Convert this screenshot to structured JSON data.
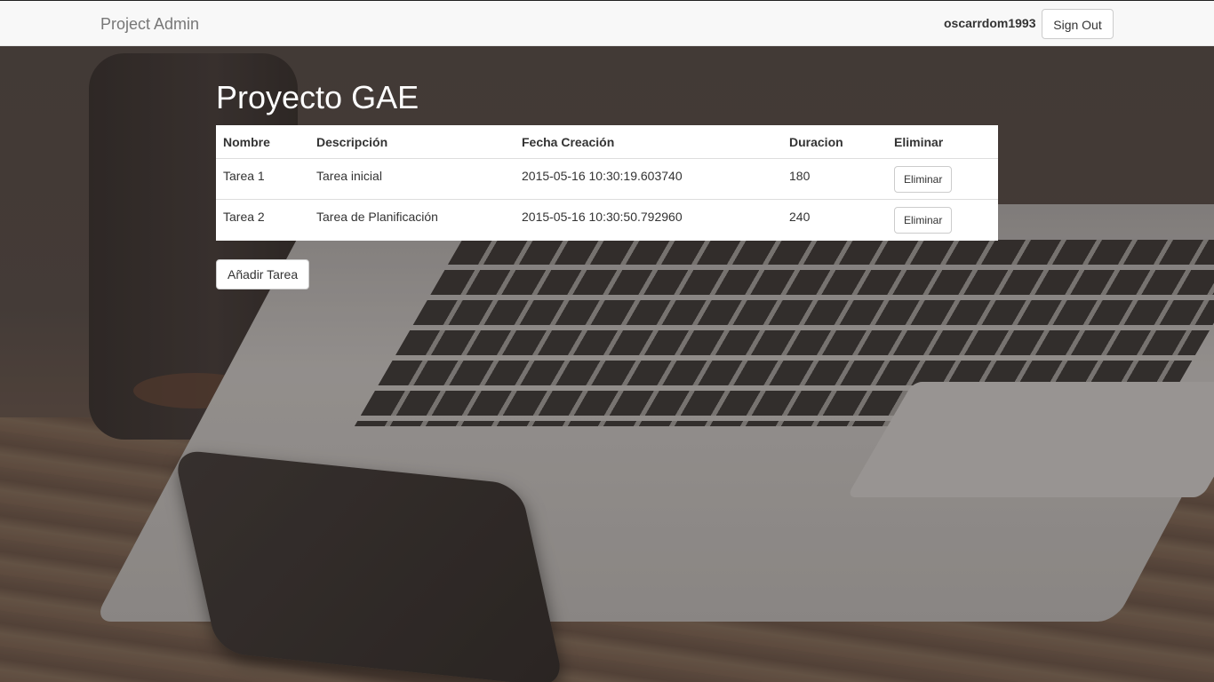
{
  "navbar": {
    "brand": "Project Admin",
    "username": "oscarrdom1993",
    "sign_out_label": "Sign Out"
  },
  "page": {
    "title": "Proyecto GAE",
    "add_button_label": "Añadir Tarea"
  },
  "table": {
    "headers": [
      "Nombre",
      "Descripción",
      "Fecha Creación",
      "Duracion",
      "Eliminar"
    ],
    "rows": [
      {
        "nombre": "Tarea 1",
        "descripcion": "Tarea inicial",
        "fecha": "2015-05-16 10:30:19.603740",
        "duracion": "180",
        "action_label": "Eliminar"
      },
      {
        "nombre": "Tarea 2",
        "descripcion": "Tarea de Planificación",
        "fecha": "2015-05-16 10:30:50.792960",
        "duracion": "240",
        "action_label": "Eliminar"
      }
    ]
  }
}
